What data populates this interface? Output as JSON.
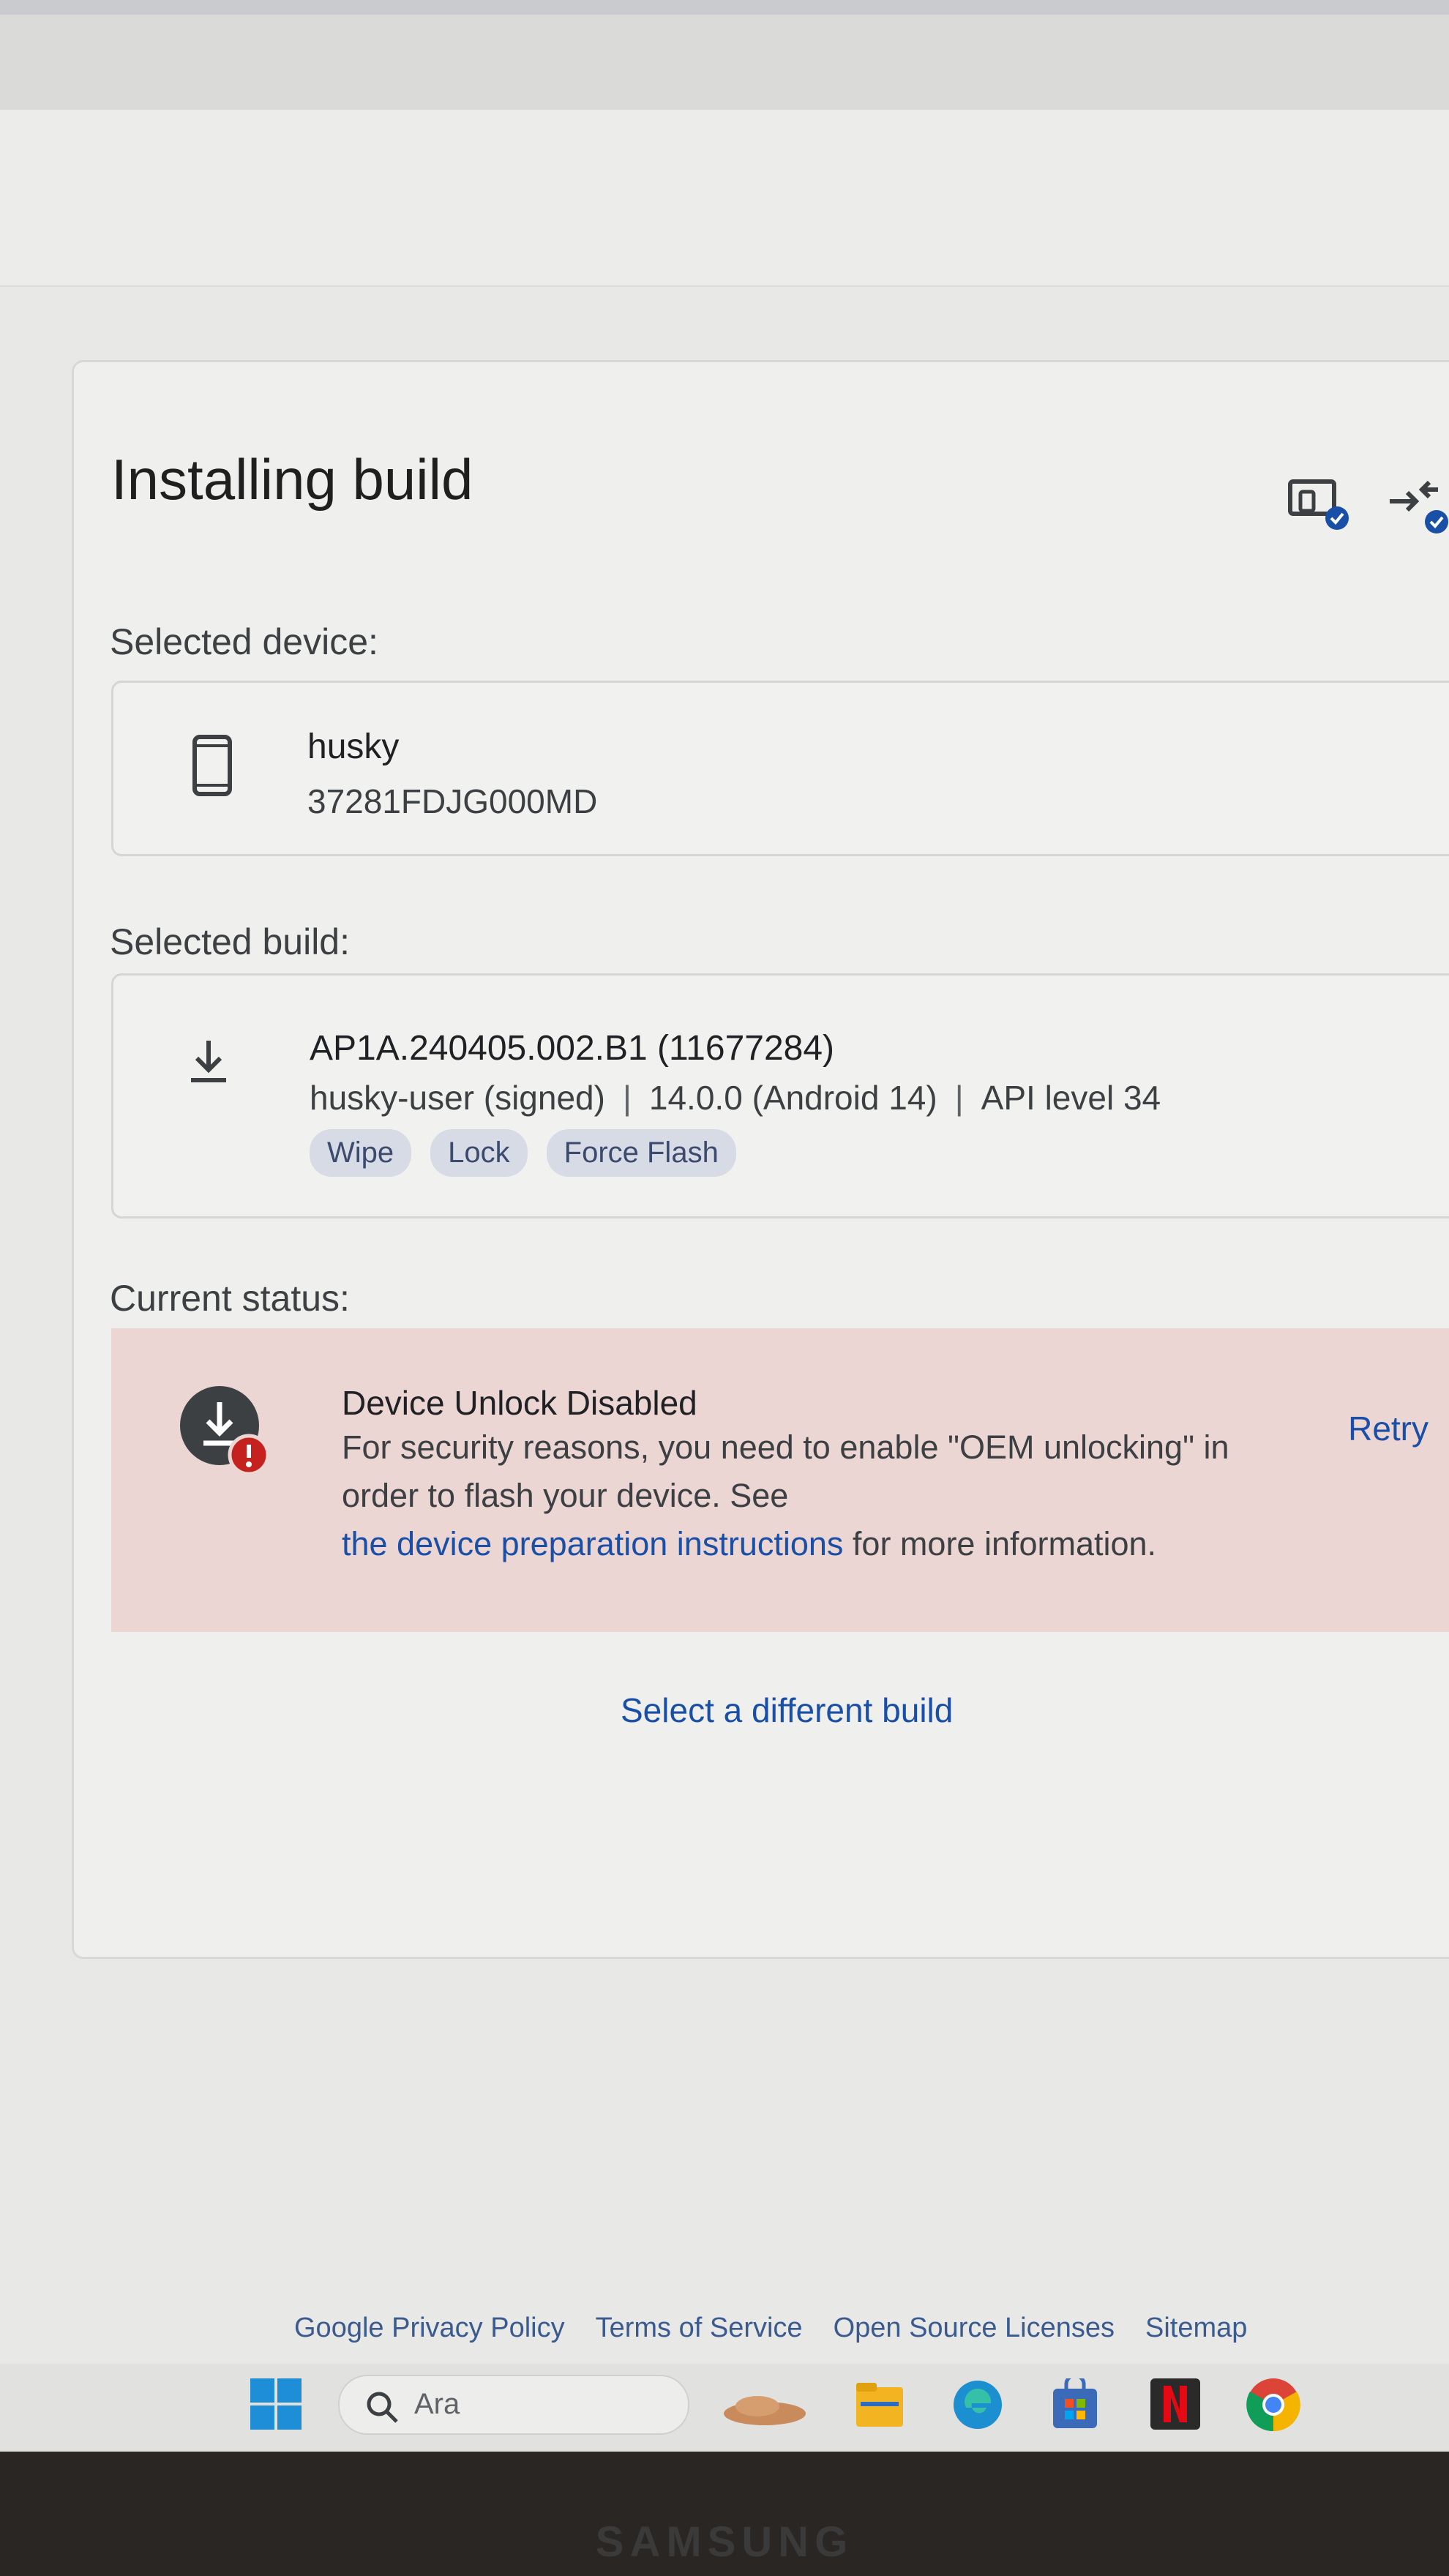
{
  "page": {
    "title": "Installing build"
  },
  "device_section": {
    "label": "Selected device:",
    "device_name": "husky",
    "serial": "37281FDJG000MD"
  },
  "build_section": {
    "label": "Selected build:",
    "build_id": "AP1A.240405.002.B1 (11677284)",
    "build_type": "husky-user (signed)",
    "version": "14.0.0 (Android 14)",
    "api_level": "API level 34",
    "separator": "|",
    "options": [
      "Wipe",
      "Lock",
      "Force Flash"
    ]
  },
  "status_section": {
    "label": "Current status:",
    "title": "Device Unlock Disabled",
    "message_part1": "For security reasons, you need to enable \"OEM unlocking\" in order to flash your device. See",
    "link_text": "the device preparation instructions",
    "message_part2": " for more information.",
    "retry_label": "Retry"
  },
  "actions": {
    "select_build_label": "Select a different build"
  },
  "footer": {
    "links": [
      "Google Privacy Policy",
      "Terms of Service",
      "Open Source Licenses",
      "Sitemap"
    ]
  },
  "taskbar": {
    "search_text": "Ara"
  },
  "monitor": {
    "brand": "SAMSUNG"
  },
  "colors": {
    "accent_link": "#1a4fa8",
    "error_bg": "#ecd6d4",
    "error_badge": "#c5221f",
    "chip_bg": "#d6dbe6"
  }
}
